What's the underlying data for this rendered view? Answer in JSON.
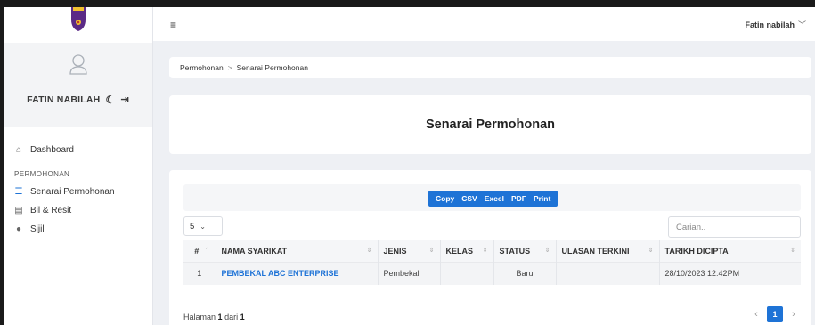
{
  "header": {
    "menu_icon": "hamburger-icon",
    "user_name": "Fatin nabilah",
    "user_chevron": "chevron-down-icon"
  },
  "sidebar": {
    "logo": "university-crest-logo",
    "user_display": "FATIN NABILAH",
    "dashboard_label": "Dashboard",
    "section_label": "PERMOHONAN",
    "items": [
      {
        "label": "Senarai Permohonan",
        "icon": "list-icon"
      },
      {
        "label": "Bil & Resit",
        "icon": "receipt-icon"
      },
      {
        "label": "Sijil",
        "icon": "dot-icon"
      }
    ]
  },
  "breadcrumb": {
    "parent": "Permohonan",
    "separator": ">",
    "current": "Senarai Permohonan"
  },
  "page": {
    "title": "Senarai Permohonan"
  },
  "table_controls": {
    "export_buttons": [
      "Copy",
      "CSV",
      "Excel",
      "PDF",
      "Print"
    ],
    "page_length": "5",
    "search_placeholder": "Carian.."
  },
  "table": {
    "columns": [
      "#",
      "NAMA SYARIKAT",
      "JENIS",
      "KELAS",
      "STATUS",
      "ULASAN TERKINI",
      "TARIKH DICIPTA"
    ],
    "rows": [
      {
        "no": "1",
        "nama": "PEMBEKAL ABC ENTERPRISE",
        "jenis": "Pembekal",
        "kelas": "",
        "status": "Baru",
        "ulasan": "",
        "tarikh": "28/10/2023 12:42PM"
      }
    ]
  },
  "pagination": {
    "prefix": "Halaman",
    "current": "1",
    "middle": "dari",
    "total": "1",
    "active_page": "1",
    "prev": "‹",
    "next": "›"
  },
  "colors": {
    "accent": "#1e73d6",
    "background": "#eef0f4"
  }
}
